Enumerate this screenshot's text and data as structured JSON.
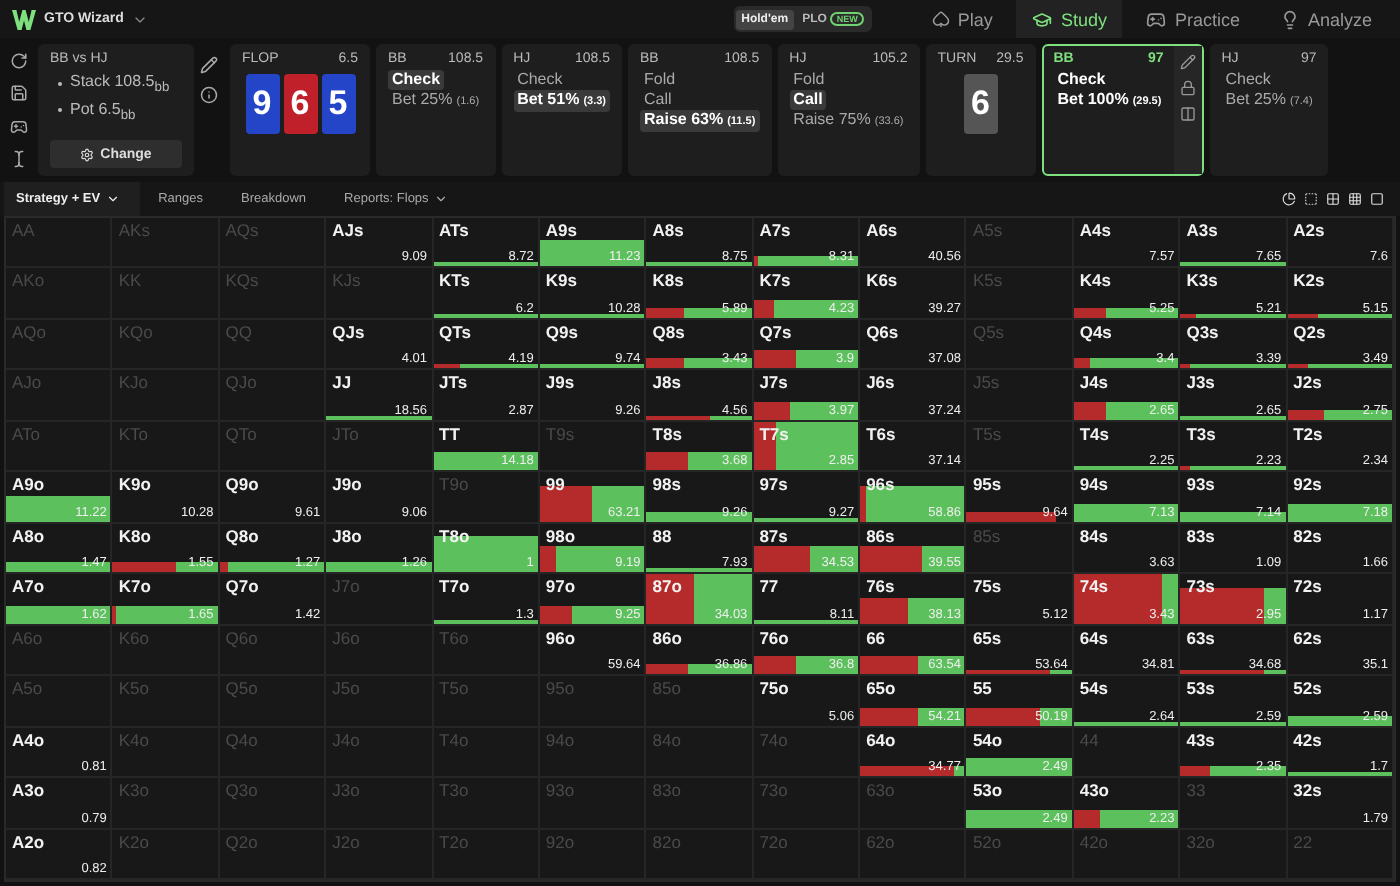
{
  "app": {
    "name": "GTO Wizard"
  },
  "game_toggle": [
    {
      "label": "Hold'em",
      "selected": true
    },
    {
      "label": "PLO",
      "badge": "NEW",
      "selected": false
    }
  ],
  "nav": [
    {
      "kind": "play",
      "label": "Play",
      "selected": false
    },
    {
      "kind": "study",
      "label": "Study",
      "selected": true
    },
    {
      "kind": "practice",
      "label": "Practice",
      "selected": false
    },
    {
      "kind": "analyze",
      "label": "Analyze",
      "selected": false
    }
  ],
  "spot": {
    "title": "BB vs HJ",
    "lines": [
      "Stack 108.5$_{bb}$",
      "Pot 6.5$_{bb}$"
    ],
    "button": "Change"
  },
  "strip": [
    {
      "kind": "street",
      "label": "FLOP",
      "pot": "6.5",
      "cards": [
        {
          "rank": "9",
          "color": "#2445c8"
        },
        {
          "rank": "6",
          "color": "#c0202a"
        },
        {
          "rank": "5",
          "color": "#2445c8"
        }
      ]
    },
    {
      "kind": "action",
      "player": "BB",
      "stack": "108.5",
      "active": false,
      "options": [
        {
          "label": "Check",
          "selected": true
        },
        {
          "label": "Bet 25%",
          "amount": "(1.6)",
          "selected": false
        }
      ]
    },
    {
      "kind": "action",
      "player": "HJ",
      "stack": "108.5",
      "active": false,
      "options": [
        {
          "label": "Check",
          "selected": false
        },
        {
          "label": "Bet 51%",
          "amount": "(3.3)",
          "selected": true
        }
      ]
    },
    {
      "kind": "action",
      "player": "BB",
      "stack": "108.5",
      "active": false,
      "options": [
        {
          "label": "Fold",
          "selected": false
        },
        {
          "label": "Call",
          "selected": false
        },
        {
          "label": "Raise 63%",
          "amount": "(11.5)",
          "selected": true
        }
      ]
    },
    {
      "kind": "action",
      "player": "HJ",
      "stack": "105.2",
      "active": false,
      "options": [
        {
          "label": "Fold",
          "selected": false
        },
        {
          "label": "Call",
          "selected": true
        },
        {
          "label": "Raise 75%",
          "amount": "(33.6)",
          "selected": false
        }
      ]
    },
    {
      "kind": "street",
      "label": "TURN",
      "pot": "29.5",
      "cards": [
        {
          "rank": "6",
          "color": "#555555"
        }
      ]
    },
    {
      "kind": "action",
      "player": "BB",
      "stack": "97",
      "active": true,
      "options": [
        {
          "label": "Check",
          "selected": false
        },
        {
          "label": "Bet 100%",
          "amount": "(29.5)",
          "selected": false
        }
      ]
    },
    {
      "kind": "action",
      "player": "HJ",
      "stack": "97",
      "active": false,
      "options": [
        {
          "label": "Check",
          "selected": false
        },
        {
          "label": "Bet 25%",
          "amount": "(7.4)",
          "selected": false
        }
      ]
    }
  ],
  "view_tabs": [
    {
      "label": "Strategy + EV",
      "dropdown": true,
      "selected": true
    },
    {
      "label": "Ranges",
      "dropdown": false,
      "selected": false
    },
    {
      "label": "Breakdown",
      "dropdown": false,
      "selected": false
    },
    {
      "label": "Reports: Flops",
      "dropdown": true,
      "selected": false
    }
  ],
  "grid": {
    "rows": [
      [
        {
          "hand": "AA",
          "active": false
        },
        {
          "hand": "AKs",
          "active": false
        },
        {
          "hand": "AQs",
          "active": false
        },
        {
          "hand": "AJs",
          "active": true,
          "value": "9.09"
        },
        {
          "hand": "ATs",
          "active": true,
          "value": "8.72",
          "kind": "line",
          "bar": {
            "check": {
              "level": 1
            }
          }
        },
        {
          "hand": "A9s",
          "active": true,
          "value": "11.23",
          "kind": "high",
          "bar": {
            "check": {
              "level": 1
            }
          }
        },
        {
          "hand": "A8s",
          "active": true,
          "value": "8.75",
          "kind": "line",
          "bar": {
            "check": {
              "level": 1
            }
          }
        },
        {
          "hand": "A7s",
          "active": true,
          "value": "8.31",
          "kind": "low",
          "bar": {
            "bet": {
              "level": 0.04
            },
            "check": {
              "level": 0.96
            }
          }
        },
        {
          "hand": "A6s",
          "active": true,
          "value": "40.56"
        },
        {
          "hand": "A5s",
          "active": false
        },
        {
          "hand": "A4s",
          "active": true,
          "value": "7.57"
        },
        {
          "hand": "A3s",
          "active": true,
          "value": "7.65",
          "kind": "line",
          "bar": {
            "check": {
              "level": 1
            }
          }
        },
        {
          "hand": "A2s",
          "active": true,
          "value": "7.6"
        }
      ],
      [
        {
          "hand": "AKo",
          "active": false
        },
        {
          "hand": "KK",
          "active": false
        },
        {
          "hand": "KQs",
          "active": false
        },
        {
          "hand": "KJs",
          "active": false
        },
        {
          "hand": "KTs",
          "active": true,
          "value": "6.2",
          "kind": "line",
          "bar": {
            "check": {
              "level": 1
            }
          }
        },
        {
          "hand": "K9s",
          "active": true,
          "value": "10.28",
          "kind": "line",
          "bar": {
            "check": {
              "level": 1
            }
          }
        },
        {
          "hand": "K8s",
          "active": true,
          "value": "5.89",
          "kind": "low",
          "bar": {
            "bet": {
              "level": 0.35
            },
            "check": {
              "level": 0.65
            }
          }
        },
        {
          "hand": "K7s",
          "active": true,
          "value": "4.23",
          "kind": "mid",
          "bar": {
            "bet": {
              "level": 0.2
            },
            "check": {
              "level": 0.8
            }
          }
        },
        {
          "hand": "K6s",
          "active": true,
          "value": "39.27"
        },
        {
          "hand": "K5s",
          "active": false
        },
        {
          "hand": "K4s",
          "active": true,
          "value": "5.25",
          "kind": "low",
          "bar": {
            "bet": {
              "level": 0.3
            },
            "check": {
              "level": 0.7
            }
          }
        },
        {
          "hand": "K3s",
          "active": true,
          "value": "5.21",
          "kind": "line",
          "bar": {
            "bet": {
              "level": 0.15
            },
            "check": {
              "level": 0.85
            }
          }
        },
        {
          "hand": "K2s",
          "active": true,
          "value": "5.15",
          "kind": "line",
          "bar": {
            "bet": {
              "level": 0.3
            },
            "check": {
              "level": 0.7
            }
          }
        }
      ],
      [
        {
          "hand": "AQo",
          "active": false
        },
        {
          "hand": "KQo",
          "active": false
        },
        {
          "hand": "QQ",
          "active": false
        },
        {
          "hand": "QJs",
          "active": true,
          "value": "4.01"
        },
        {
          "hand": "QTs",
          "active": true,
          "value": "4.19",
          "kind": "line",
          "bar": {
            "bet": {
              "level": 0.25
            },
            "check": {
              "level": 0.75
            }
          }
        },
        {
          "hand": "Q9s",
          "active": true,
          "value": "9.74",
          "kind": "line",
          "bar": {
            "check": {
              "level": 1
            }
          }
        },
        {
          "hand": "Q8s",
          "active": true,
          "value": "3.43",
          "kind": "low",
          "bar": {
            "bet": {
              "level": 0.35
            },
            "check": {
              "level": 0.65
            }
          }
        },
        {
          "hand": "Q7s",
          "active": true,
          "value": "3.9",
          "kind": "mid",
          "bar": {
            "bet": {
              "level": 0.4
            },
            "check": {
              "level": 0.6
            }
          }
        },
        {
          "hand": "Q6s",
          "active": true,
          "value": "37.08"
        },
        {
          "hand": "Q5s",
          "active": false
        },
        {
          "hand": "Q4s",
          "active": true,
          "value": "3.4",
          "kind": "low",
          "bar": {
            "bet": {
              "level": 0.15
            },
            "check": {
              "level": 0.85
            }
          }
        },
        {
          "hand": "Q3s",
          "active": true,
          "value": "3.39",
          "kind": "line",
          "bar": {
            "bet": {
              "level": 0.1
            },
            "check": {
              "level": 0.9
            }
          }
        },
        {
          "hand": "Q2s",
          "active": true,
          "value": "3.49",
          "kind": "line",
          "bar": {
            "bet": {
              "level": 0.2
            },
            "check": {
              "level": 0.8
            }
          }
        }
      ],
      [
        {
          "hand": "AJo",
          "active": false
        },
        {
          "hand": "KJo",
          "active": false
        },
        {
          "hand": "QJo",
          "active": false
        },
        {
          "hand": "JJ",
          "active": true,
          "value": "18.56",
          "kind": "line",
          "bar": {
            "check": {
              "level": 1
            }
          }
        },
        {
          "hand": "JTs",
          "active": true,
          "value": "2.87"
        },
        {
          "hand": "J9s",
          "active": true,
          "value": "9.26"
        },
        {
          "hand": "J8s",
          "active": true,
          "value": "4.56",
          "kind": "line",
          "bar": {
            "bet": {
              "level": 0.6
            },
            "check": {
              "level": 0.4
            }
          }
        },
        {
          "hand": "J7s",
          "active": true,
          "value": "3.97",
          "kind": "mid",
          "bar": {
            "bet": {
              "level": 0.35
            },
            "check": {
              "level": 0.65
            }
          }
        },
        {
          "hand": "J6s",
          "active": true,
          "value": "37.24"
        },
        {
          "hand": "J5s",
          "active": false
        },
        {
          "hand": "J4s",
          "active": true,
          "value": "2.65",
          "kind": "mid",
          "bar": {
            "bet": {
              "level": 0.3
            },
            "check": {
              "level": 0.7
            }
          }
        },
        {
          "hand": "J3s",
          "active": true,
          "value": "2.65",
          "kind": "line",
          "bar": {
            "check": {
              "level": 1
            }
          }
        },
        {
          "hand": "J2s",
          "active": true,
          "value": "2.75",
          "kind": "low",
          "bar": {
            "bet": {
              "level": 0.35
            },
            "check": {
              "level": 0.65
            }
          }
        }
      ],
      [
        {
          "hand": "ATo",
          "active": false
        },
        {
          "hand": "KTo",
          "active": false
        },
        {
          "hand": "QTo",
          "active": false
        },
        {
          "hand": "JTo",
          "active": false
        },
        {
          "hand": "TT",
          "active": true,
          "value": "14.18",
          "kind": "mid",
          "bar": {
            "check": {
              "level": 1
            }
          }
        },
        {
          "hand": "T9s",
          "active": false
        },
        {
          "hand": "T8s",
          "active": true,
          "value": "3.68",
          "kind": "mid",
          "bar": {
            "bet": {
              "level": 0.4
            },
            "check": {
              "level": 0.6
            }
          }
        },
        {
          "hand": "T7s",
          "active": true,
          "value": "2.85",
          "kind": "full",
          "bar": {
            "bet": {
              "level": 0.22
            },
            "check": {
              "level": 0.78
            }
          }
        },
        {
          "hand": "T6s",
          "active": true,
          "value": "37.14"
        },
        {
          "hand": "T5s",
          "active": false
        },
        {
          "hand": "T4s",
          "active": true,
          "value": "2.25",
          "kind": "line",
          "bar": {
            "check": {
              "level": 1
            }
          }
        },
        {
          "hand": "T3s",
          "active": true,
          "value": "2.23",
          "kind": "line",
          "bar": {
            "bet": {
              "level": 0.1
            },
            "check": {
              "level": 0.9
            }
          }
        },
        {
          "hand": "T2s",
          "active": true,
          "value": "2.34"
        }
      ],
      [
        {
          "hand": "A9o",
          "active": true,
          "value": "11.22",
          "kind": "high",
          "bar": {
            "check": {
              "level": 1
            }
          }
        },
        {
          "hand": "K9o",
          "active": true,
          "value": "10.28"
        },
        {
          "hand": "Q9o",
          "active": true,
          "value": "9.61"
        },
        {
          "hand": "J9o",
          "active": true,
          "value": "9.06"
        },
        {
          "hand": "T9o",
          "active": false
        },
        {
          "hand": "99",
          "active": true,
          "value": "63.21",
          "kind": "tall",
          "bar": {
            "bet": {
              "level": 0.5
            },
            "check": {
              "level": 0.5
            }
          }
        },
        {
          "hand": "98s",
          "active": true,
          "value": "9.26",
          "kind": "low",
          "bar": {
            "check": {
              "level": 1
            }
          }
        },
        {
          "hand": "97s",
          "active": true,
          "value": "9.27",
          "kind": "line",
          "bar": {
            "check": {
              "level": 1
            }
          }
        },
        {
          "hand": "96s",
          "active": true,
          "value": "58.86",
          "kind": "tall",
          "bar": {
            "bet": {
              "level": 0.05
            },
            "check": {
              "level": 0.95
            }
          }
        },
        {
          "hand": "95s",
          "active": true,
          "value": "9.64",
          "kind": "low",
          "bar": {
            "bet": {
              "level": 0.85
            }
          }
        },
        {
          "hand": "94s",
          "active": true,
          "value": "7.13",
          "kind": "mid",
          "bar": {
            "check": {
              "level": 1
            }
          }
        },
        {
          "hand": "93s",
          "active": true,
          "value": "7.14",
          "kind": "low",
          "bar": {
            "check": {
              "level": 1
            }
          }
        },
        {
          "hand": "92s",
          "active": true,
          "value": "7.18",
          "kind": "mid",
          "bar": {
            "check": {
              "level": 1
            }
          }
        }
      ],
      [
        {
          "hand": "A8o",
          "active": true,
          "value": "1.47",
          "kind": "low",
          "bar": {
            "check": {
              "level": 1
            }
          }
        },
        {
          "hand": "K8o",
          "active": true,
          "value": "1.55",
          "kind": "low",
          "bar": {
            "bet": {
              "level": 0.6
            },
            "check": {
              "level": 0.4
            }
          }
        },
        {
          "hand": "Q8o",
          "active": true,
          "value": "1.27",
          "kind": "low",
          "bar": {
            "bet": {
              "level": 0.08
            },
            "check": {
              "level": 0.92
            }
          }
        },
        {
          "hand": "J8o",
          "active": true,
          "value": "1.26",
          "kind": "low",
          "bar": {
            "check": {
              "level": 1
            }
          }
        },
        {
          "hand": "T8o",
          "active": true,
          "value": "1",
          "kind": "tall",
          "bar": {
            "check": {
              "level": 1
            }
          }
        },
        {
          "hand": "98o",
          "active": true,
          "value": "9.19",
          "kind": "high",
          "bar": {
            "bet": {
              "level": 0.15
            },
            "check": {
              "level": 0.85
            }
          }
        },
        {
          "hand": "88",
          "active": true,
          "value": "7.93",
          "kind": "line",
          "bar": {
            "check": {
              "level": 1
            }
          }
        },
        {
          "hand": "87s",
          "active": true,
          "value": "34.53",
          "kind": "high",
          "bar": {
            "bet": {
              "level": 0.55
            },
            "check": {
              "level": 0.45
            }
          }
        },
        {
          "hand": "86s",
          "active": true,
          "value": "39.55",
          "kind": "high",
          "bar": {
            "bet": {
              "level": 0.6
            },
            "check": {
              "level": 0.4
            }
          }
        },
        {
          "hand": "85s",
          "active": false
        },
        {
          "hand": "84s",
          "active": true,
          "value": "3.63"
        },
        {
          "hand": "83s",
          "active": true,
          "value": "1.09"
        },
        {
          "hand": "82s",
          "active": true,
          "value": "1.66"
        }
      ],
      [
        {
          "hand": "A7o",
          "active": true,
          "value": "1.62",
          "kind": "mid",
          "bar": {
            "check": {
              "level": 1
            }
          }
        },
        {
          "hand": "K7o",
          "active": true,
          "value": "1.65",
          "kind": "mid",
          "bar": {
            "bet": {
              "level": 0.03
            },
            "check": {
              "level": 0.97
            }
          }
        },
        {
          "hand": "Q7o",
          "active": true,
          "value": "1.42"
        },
        {
          "hand": "J7o",
          "active": false
        },
        {
          "hand": "T7o",
          "active": true,
          "value": "1.3",
          "kind": "line",
          "bar": {
            "check": {
              "level": 1
            }
          }
        },
        {
          "hand": "97o",
          "active": true,
          "value": "9.25",
          "kind": "mid",
          "bar": {
            "bet": {
              "level": 0.3
            },
            "check": {
              "level": 0.7
            }
          }
        },
        {
          "hand": "87o",
          "active": true,
          "value": "34.03",
          "kind": "full",
          "bar": {
            "bet": {
              "level": 0.45
            },
            "check": {
              "level": 0.55
            }
          }
        },
        {
          "hand": "77",
          "active": true,
          "value": "8.11",
          "kind": "line",
          "bar": {
            "check": {
              "level": 1
            }
          }
        },
        {
          "hand": "76s",
          "active": true,
          "value": "38.13",
          "kind": "high",
          "bar": {
            "bet": {
              "level": 0.45
            },
            "check": {
              "level": 0.55
            }
          }
        },
        {
          "hand": "75s",
          "active": true,
          "value": "5.12"
        },
        {
          "hand": "74s",
          "active": true,
          "value": "3.43",
          "kind": "full",
          "bar": {
            "bet": {
              "level": 0.85
            },
            "check": {
              "level": 0.15
            }
          }
        },
        {
          "hand": "73s",
          "active": true,
          "value": "2.95",
          "kind": "tall",
          "bar": {
            "bet": {
              "level": 0.8
            },
            "check": {
              "level": 0.2
            }
          }
        },
        {
          "hand": "72s",
          "active": true,
          "value": "1.17"
        }
      ],
      [
        {
          "hand": "A6o",
          "active": false
        },
        {
          "hand": "K6o",
          "active": false
        },
        {
          "hand": "Q6o",
          "active": false
        },
        {
          "hand": "J6o",
          "active": false
        },
        {
          "hand": "T6o",
          "active": false
        },
        {
          "hand": "96o",
          "active": true,
          "value": "59.64"
        },
        {
          "hand": "86o",
          "active": true,
          "value": "36.86",
          "kind": "low",
          "bar": {
            "bet": {
              "level": 0.4
            },
            "check": {
              "level": 0.6
            }
          }
        },
        {
          "hand": "76o",
          "active": true,
          "value": "36.8",
          "kind": "mid",
          "bar": {
            "bet": {
              "level": 0.4
            },
            "check": {
              "level": 0.6
            }
          }
        },
        {
          "hand": "66",
          "active": true,
          "value": "63.54",
          "kind": "mid",
          "bar": {
            "bet": {
              "level": 0.55
            },
            "check": {
              "level": 0.45
            }
          }
        },
        {
          "hand": "65s",
          "active": true,
          "value": "53.64",
          "kind": "line",
          "bar": {
            "bet": {
              "level": 0.8
            },
            "check": {
              "level": 0.2
            }
          }
        },
        {
          "hand": "64s",
          "active": true,
          "value": "34.81"
        },
        {
          "hand": "63s",
          "active": true,
          "value": "34.68",
          "kind": "line",
          "bar": {
            "bet": {
              "level": 0.8
            },
            "check": {
              "level": 0.2
            }
          }
        },
        {
          "hand": "62s",
          "active": true,
          "value": "35.1"
        }
      ],
      [
        {
          "hand": "A5o",
          "active": false
        },
        {
          "hand": "K5o",
          "active": false
        },
        {
          "hand": "Q5o",
          "active": false
        },
        {
          "hand": "J5o",
          "active": false
        },
        {
          "hand": "T5o",
          "active": false
        },
        {
          "hand": "95o",
          "active": false
        },
        {
          "hand": "85o",
          "active": false
        },
        {
          "hand": "75o",
          "active": true,
          "value": "5.06"
        },
        {
          "hand": "65o",
          "active": true,
          "value": "54.21",
          "kind": "mid",
          "bar": {
            "bet": {
              "level": 0.55
            },
            "check": {
              "level": 0.45
            }
          }
        },
        {
          "hand": "55",
          "active": true,
          "value": "50.19",
          "kind": "mid",
          "bar": {
            "bet": {
              "level": 0.7
            },
            "check": {
              "level": 0.3
            }
          }
        },
        {
          "hand": "54s",
          "active": true,
          "value": "2.64",
          "kind": "line",
          "bar": {
            "check": {
              "level": 1
            }
          }
        },
        {
          "hand": "53s",
          "active": true,
          "value": "2.59",
          "kind": "line",
          "bar": {
            "check": {
              "level": 1
            }
          }
        },
        {
          "hand": "52s",
          "active": true,
          "value": "2.59",
          "kind": "low",
          "bar": {
            "check": {
              "level": 1
            }
          }
        }
      ],
      [
        {
          "hand": "A4o",
          "active": true,
          "value": "0.81"
        },
        {
          "hand": "K4o",
          "active": false
        },
        {
          "hand": "Q4o",
          "active": false
        },
        {
          "hand": "J4o",
          "active": false
        },
        {
          "hand": "T4o",
          "active": false
        },
        {
          "hand": "94o",
          "active": false
        },
        {
          "hand": "84o",
          "active": false
        },
        {
          "hand": "74o",
          "active": false
        },
        {
          "hand": "64o",
          "active": true,
          "value": "34.77",
          "kind": "low",
          "bar": {
            "bet": {
              "level": 0.9
            },
            "check": {
              "level": 0.1
            }
          }
        },
        {
          "hand": "54o",
          "active": true,
          "value": "2.49",
          "kind": "mid",
          "bar": {
            "check": {
              "level": 1
            }
          }
        },
        {
          "hand": "44",
          "active": false
        },
        {
          "hand": "43s",
          "active": true,
          "value": "2.35",
          "kind": "low",
          "bar": {
            "bet": {
              "level": 0.28
            },
            "check": {
              "level": 0.72
            }
          }
        },
        {
          "hand": "42s",
          "active": true,
          "value": "1.7",
          "kind": "line",
          "bar": {
            "check": {
              "level": 1
            }
          }
        }
      ],
      [
        {
          "hand": "A3o",
          "active": true,
          "value": "0.79"
        },
        {
          "hand": "K3o",
          "active": false
        },
        {
          "hand": "Q3o",
          "active": false
        },
        {
          "hand": "J3o",
          "active": false
        },
        {
          "hand": "T3o",
          "active": false
        },
        {
          "hand": "93o",
          "active": false
        },
        {
          "hand": "83o",
          "active": false
        },
        {
          "hand": "73o",
          "active": false
        },
        {
          "hand": "63o",
          "active": false
        },
        {
          "hand": "53o",
          "active": true,
          "value": "2.49",
          "kind": "mid",
          "bar": {
            "check": {
              "level": 1
            }
          }
        },
        {
          "hand": "43o",
          "active": true,
          "value": "2.23",
          "kind": "mid",
          "bar": {
            "bet": {
              "level": 0.25
            },
            "check": {
              "level": 0.75
            }
          }
        },
        {
          "hand": "33",
          "active": false
        },
        {
          "hand": "32s",
          "active": true,
          "value": "1.79"
        }
      ],
      [
        {
          "hand": "A2o",
          "active": true,
          "value": "0.82"
        },
        {
          "hand": "K2o",
          "active": false
        },
        {
          "hand": "Q2o",
          "active": false
        },
        {
          "hand": "J2o",
          "active": false
        },
        {
          "hand": "T2o",
          "active": false
        },
        {
          "hand": "92o",
          "active": false
        },
        {
          "hand": "82o",
          "active": false
        },
        {
          "hand": "72o",
          "active": false
        },
        {
          "hand": "62o",
          "active": false
        },
        {
          "hand": "52o",
          "active": false
        },
        {
          "hand": "42o",
          "active": false
        },
        {
          "hand": "32o",
          "active": false
        },
        {
          "hand": "22",
          "active": false
        }
      ]
    ]
  }
}
